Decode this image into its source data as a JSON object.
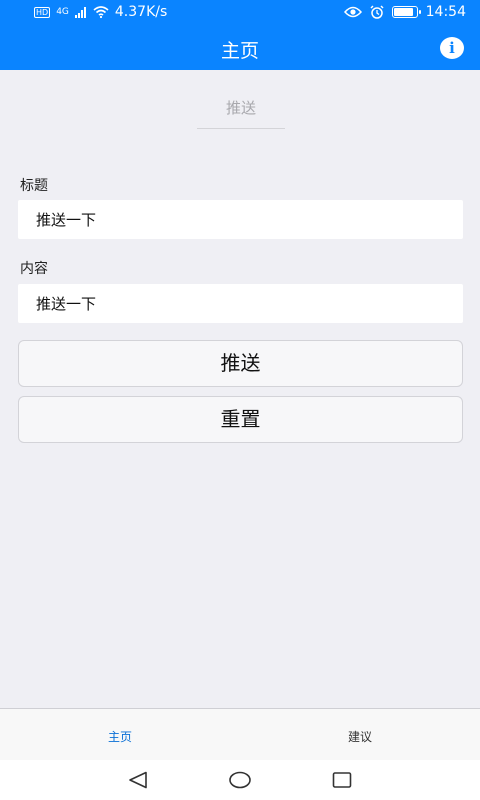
{
  "status_bar": {
    "hd": "HD",
    "net_type": "4G",
    "speed": "4.37K/s",
    "time": "14:54",
    "battery_level": 0.9
  },
  "nav": {
    "title": "主页",
    "info_icon": "i"
  },
  "segment": {
    "label": "推送"
  },
  "form": {
    "title_label": "标题",
    "title_value": "推送一下",
    "content_label": "内容",
    "content_value": "推送一下"
  },
  "buttons": {
    "push": "推送",
    "reset": "重置"
  },
  "tabs": [
    {
      "label": "主页",
      "active": true
    },
    {
      "label": "建议",
      "active": false
    }
  ],
  "colors": {
    "accent": "#0a84ff",
    "active_tab": "#0a6fd6",
    "background": "#efeff4"
  },
  "icons": [
    "eye-icon",
    "alarm-icon",
    "battery-icon",
    "wifi-icon",
    "signal-icon",
    "info-icon",
    "back-icon",
    "home-icon",
    "recents-icon"
  ]
}
